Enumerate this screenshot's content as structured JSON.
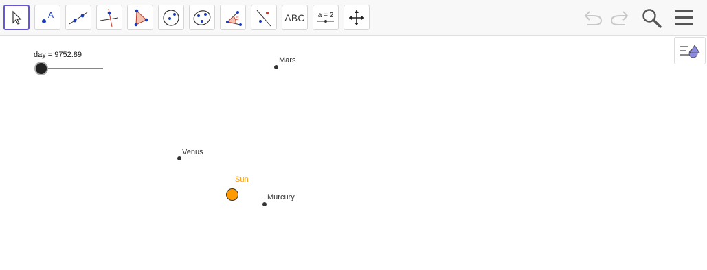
{
  "toolbar": {
    "text_tool_label": "ABC",
    "slider_tool_label": "a = 2",
    "tools": [
      "move-tool",
      "point-tool",
      "line-tool",
      "perpendicular-tool",
      "polygon-tool",
      "circle-tool",
      "conic-tool",
      "angle-tool",
      "reflect-tool",
      "text-tool",
      "slider-tool",
      "move-graphics-tool"
    ]
  },
  "slider": {
    "label": "day = 9752.89",
    "name": "day",
    "value": 9752.89
  },
  "objects": {
    "sun": {
      "label": "Sun",
      "color": "#ff9900"
    },
    "mercury": {
      "label": "Murcury"
    },
    "venus": {
      "label": "Venus"
    },
    "mars": {
      "label": "Mars"
    }
  },
  "colors": {
    "accent": "#6557d2",
    "sun_label": "#ff9900",
    "point": "#333333"
  }
}
